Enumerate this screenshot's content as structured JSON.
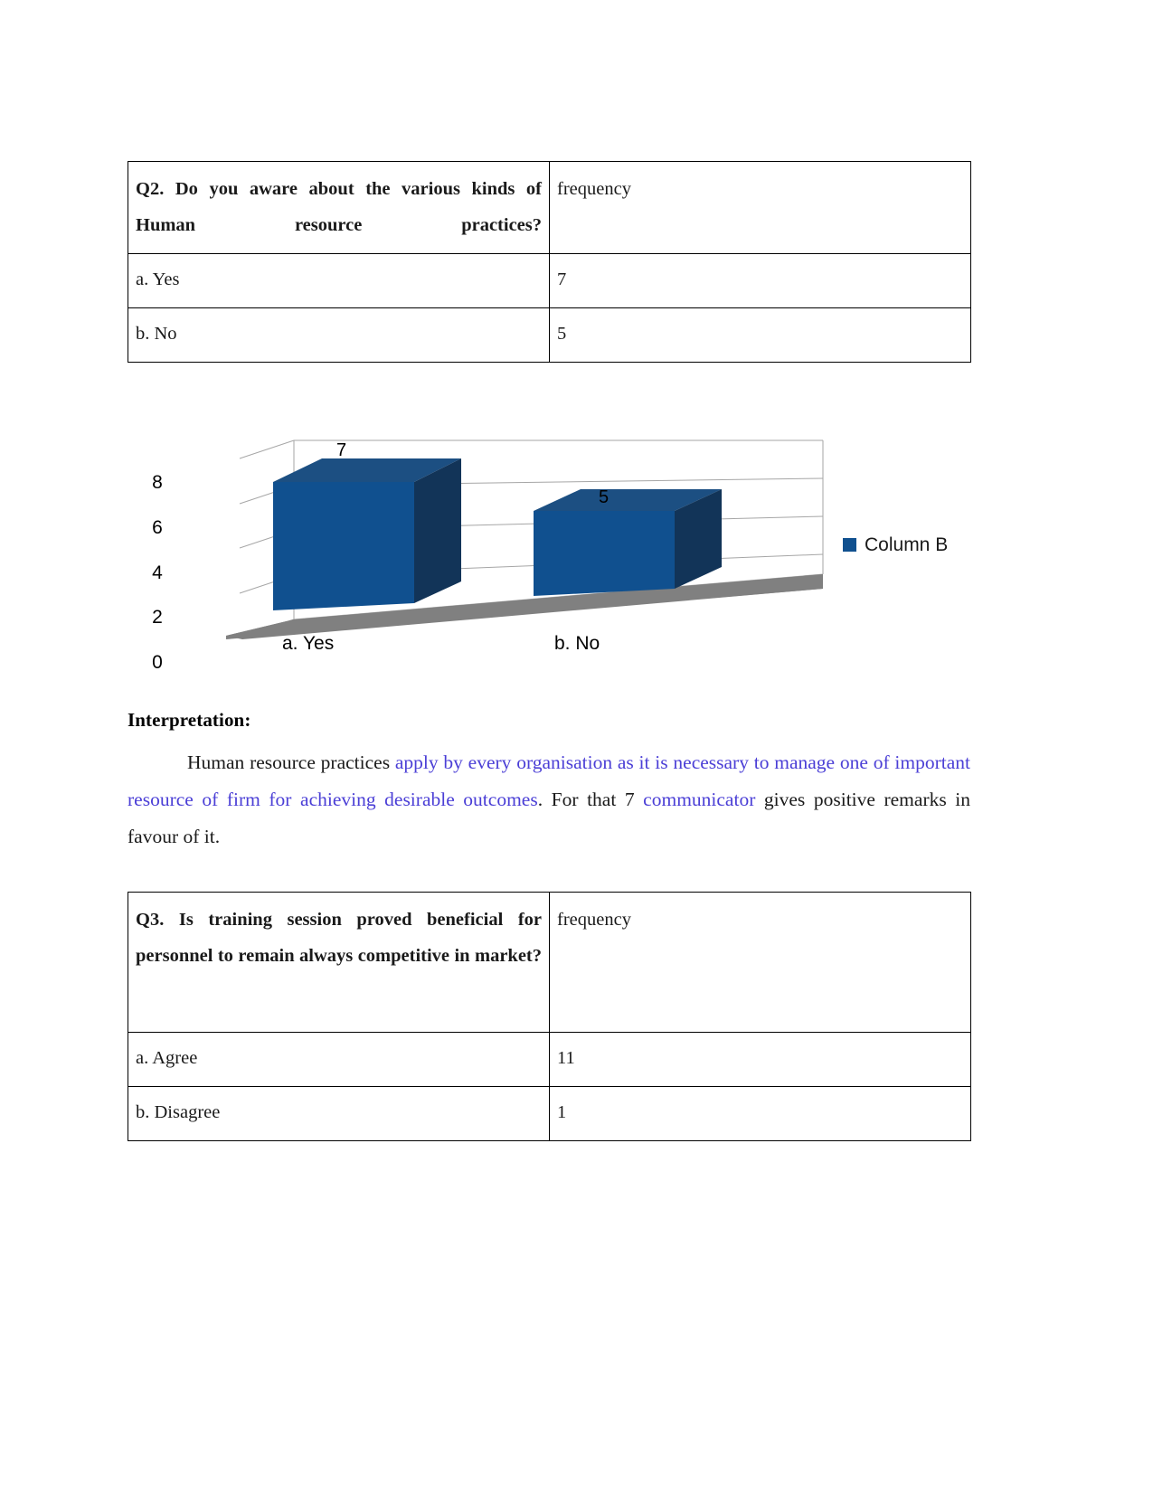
{
  "tables": [
    {
      "id": "q2",
      "question": "Q2. Do you aware about the various kinds of Human resource practices?",
      "freq_header": "frequency",
      "rows": [
        {
          "option": "a. Yes",
          "frequency": "7"
        },
        {
          "option": "b. No",
          "frequency": "5"
        }
      ]
    },
    {
      "id": "q3",
      "question": "Q3. Is training session proved beneficial for personnel to remain always competitive in market?",
      "freq_header": "frequency",
      "rows": [
        {
          "option": "a. Agree",
          "frequency": "11"
        },
        {
          "option": "b. Disagree",
          "frequency": "1"
        }
      ]
    }
  ],
  "interpretation": {
    "heading": "Interpretation:",
    "segments": [
      {
        "text": "Human resource practices ",
        "highlight": false
      },
      {
        "text": "apply by every organisation as it is necessary to manage one of important resource of firm for achieving desirable outcomes",
        "highlight": true
      },
      {
        "text": ". For that 7 ",
        "highlight": false
      },
      {
        "text": "communicator",
        "highlight": true
      },
      {
        "text": " gives positive remarks in favour of it.",
        "highlight": false
      }
    ],
    "highlight_color": "#4b3fd6"
  },
  "chart_data": {
    "type": "bar",
    "subtype": "3d-clustered-column",
    "title": "",
    "xlabel": "",
    "ylabel": "",
    "categories": [
      "a. Yes",
      "b. No"
    ],
    "values": [
      7,
      5
    ],
    "data_labels": [
      "7",
      "5"
    ],
    "series": [
      {
        "name": "Column B",
        "values": [
          7,
          5
        ]
      }
    ],
    "legend": {
      "entries": [
        "Column B"
      ],
      "position": "right"
    },
    "ylim": [
      0,
      8
    ],
    "yticks": [
      "0",
      "2",
      "4",
      "6",
      "8"
    ],
    "ytick_values": [
      0,
      2,
      4,
      6,
      8
    ],
    "grid": true,
    "colors": {
      "bar_front": "#11508f",
      "bar_top": "#1c4f82",
      "bar_side": "#12355e",
      "floor": "#808080",
      "wall": "#ffffff",
      "gridline": "#a6a6a6",
      "legend_swatch": "#10508f"
    }
  }
}
